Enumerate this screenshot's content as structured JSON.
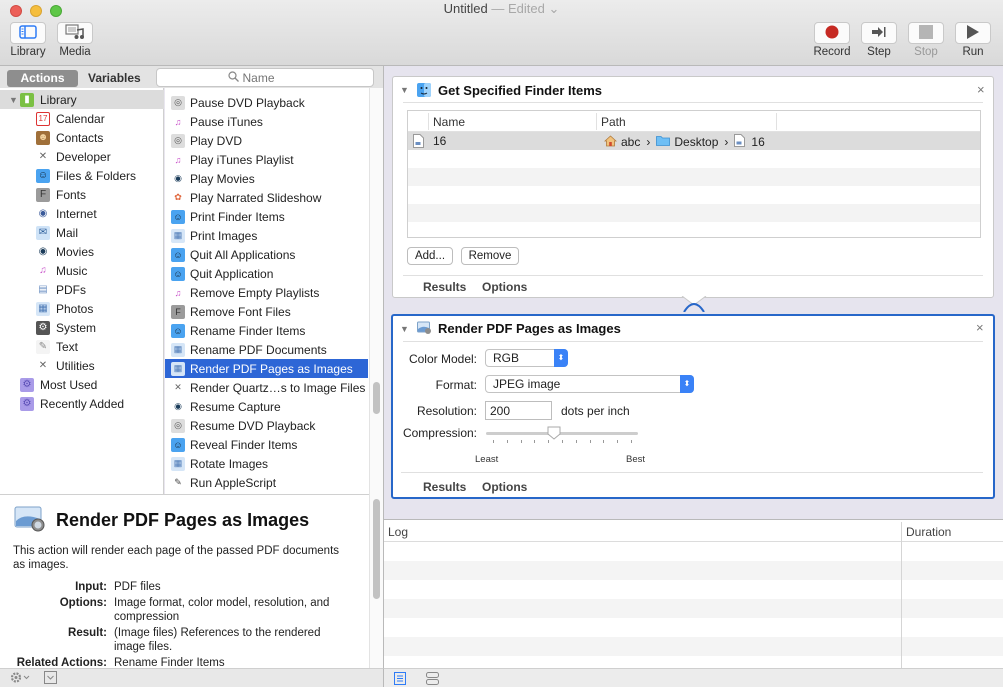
{
  "window": {
    "title": "Untitled",
    "title_suffix": " — Edited",
    "title_chevron": "⌄"
  },
  "toolbar": {
    "left": [
      {
        "label": "Library",
        "icon": "library-icon"
      },
      {
        "label": "Media",
        "icon": "media-icon"
      }
    ],
    "right": [
      {
        "label": "Record",
        "icon": "record-icon",
        "enabled": true
      },
      {
        "label": "Step",
        "icon": "step-icon",
        "enabled": true
      },
      {
        "label": "Stop",
        "icon": "stop-icon",
        "enabled": false
      },
      {
        "label": "Run",
        "icon": "run-icon",
        "enabled": true
      }
    ]
  },
  "library": {
    "tabs": {
      "actions": "Actions",
      "variables": "Variables",
      "selected": "Actions"
    },
    "search": {
      "placeholder": "Name",
      "value": ""
    },
    "categories": [
      {
        "label": "Library",
        "icon": "library-books-icon",
        "level": 0,
        "expanded": true,
        "selected": true
      },
      {
        "label": "Calendar",
        "icon": "calendar-icon",
        "level": 1
      },
      {
        "label": "Contacts",
        "icon": "contacts-icon",
        "level": 1
      },
      {
        "label": "Developer",
        "icon": "developer-tools-icon",
        "level": 1
      },
      {
        "label": "Files & Folders",
        "icon": "finder-icon",
        "level": 1
      },
      {
        "label": "Fonts",
        "icon": "fonts-icon",
        "level": 1
      },
      {
        "label": "Internet",
        "icon": "globe-icon",
        "level": 1
      },
      {
        "label": "Mail",
        "icon": "mail-icon",
        "level": 1
      },
      {
        "label": "Movies",
        "icon": "quicktime-icon",
        "level": 1
      },
      {
        "label": "Music",
        "icon": "music-icon",
        "level": 1
      },
      {
        "label": "PDFs",
        "icon": "pdf-icon",
        "level": 1
      },
      {
        "label": "Photos",
        "icon": "photos-icon",
        "level": 1
      },
      {
        "label": "System",
        "icon": "system-icon",
        "level": 1
      },
      {
        "label": "Text",
        "icon": "text-icon",
        "level": 1
      },
      {
        "label": "Utilities",
        "icon": "utilities-icon",
        "level": 1
      },
      {
        "label": "Most Used",
        "icon": "smart-folder-icon",
        "level": 0
      },
      {
        "label": "Recently Added",
        "icon": "smart-folder-icon",
        "level": 0
      }
    ],
    "actions": [
      {
        "label": "Pause DVD Playback",
        "icon": "dvd-icon"
      },
      {
        "label": "Pause iTunes",
        "icon": "music-icon"
      },
      {
        "label": "Play DVD",
        "icon": "dvd-icon"
      },
      {
        "label": "Play iTunes Playlist",
        "icon": "music-icon"
      },
      {
        "label": "Play Movies",
        "icon": "quicktime-icon"
      },
      {
        "label": "Play Narrated Slideshow",
        "icon": "photos-flower-icon"
      },
      {
        "label": "Print Finder Items",
        "icon": "finder-icon"
      },
      {
        "label": "Print Images",
        "icon": "preview-icon"
      },
      {
        "label": "Quit All Applications",
        "icon": "finder-icon"
      },
      {
        "label": "Quit Application",
        "icon": "finder-icon"
      },
      {
        "label": "Remove Empty Playlists",
        "icon": "music-icon"
      },
      {
        "label": "Remove Font Files",
        "icon": "fonts-icon"
      },
      {
        "label": "Rename Finder Items",
        "icon": "finder-icon"
      },
      {
        "label": "Rename PDF Documents",
        "icon": "preview-icon"
      },
      {
        "label": "Render PDF Pages as Images",
        "icon": "preview-icon",
        "selected": true
      },
      {
        "label": "Render Quartz…s to Image Files",
        "icon": "developer-tools-icon"
      },
      {
        "label": "Resume Capture",
        "icon": "quicktime-icon"
      },
      {
        "label": "Resume DVD Playback",
        "icon": "dvd-icon"
      },
      {
        "label": "Reveal Finder Items",
        "icon": "finder-icon"
      },
      {
        "label": "Rotate Images",
        "icon": "preview-icon"
      },
      {
        "label": "Run AppleScript",
        "icon": "applescript-icon"
      }
    ]
  },
  "description": {
    "title": "Render PDF Pages as Images",
    "summary": "This action will render each page of the passed PDF documents as images.",
    "fields": [
      {
        "key": "Input:",
        "value": "PDF files"
      },
      {
        "key": "Options:",
        "value": "Image format, color model, resolution, and compression"
      },
      {
        "key": "Result:",
        "value": "(Image files) References to the rendered image files."
      },
      {
        "key": "Related Actions:",
        "value": "Rename Finder Items"
      }
    ]
  },
  "workflow": {
    "action1": {
      "title": "Get Specified Finder Items",
      "columns": [
        "Name",
        "Path"
      ],
      "rows": [
        {
          "name": "16",
          "path": [
            "abc",
            "Desktop",
            "16"
          ]
        }
      ],
      "buttons": {
        "add": "Add...",
        "remove": "Remove"
      },
      "footer": {
        "results": "Results",
        "options": "Options"
      }
    },
    "action2": {
      "title": "Render PDF Pages as Images",
      "color_model": {
        "label": "Color Model:",
        "value": "RGB"
      },
      "format": {
        "label": "Format:",
        "value": "JPEG image"
      },
      "resolution": {
        "label": "Resolution:",
        "value": "200",
        "unit": "dots per inch"
      },
      "compression": {
        "label": "Compression:",
        "min_label": "Least",
        "max_label": "Best",
        "value_fraction": 0.44
      },
      "footer": {
        "results": "Results",
        "options": "Options"
      }
    }
  },
  "log": {
    "columns": {
      "log": "Log",
      "duration": "Duration"
    },
    "rows": []
  }
}
